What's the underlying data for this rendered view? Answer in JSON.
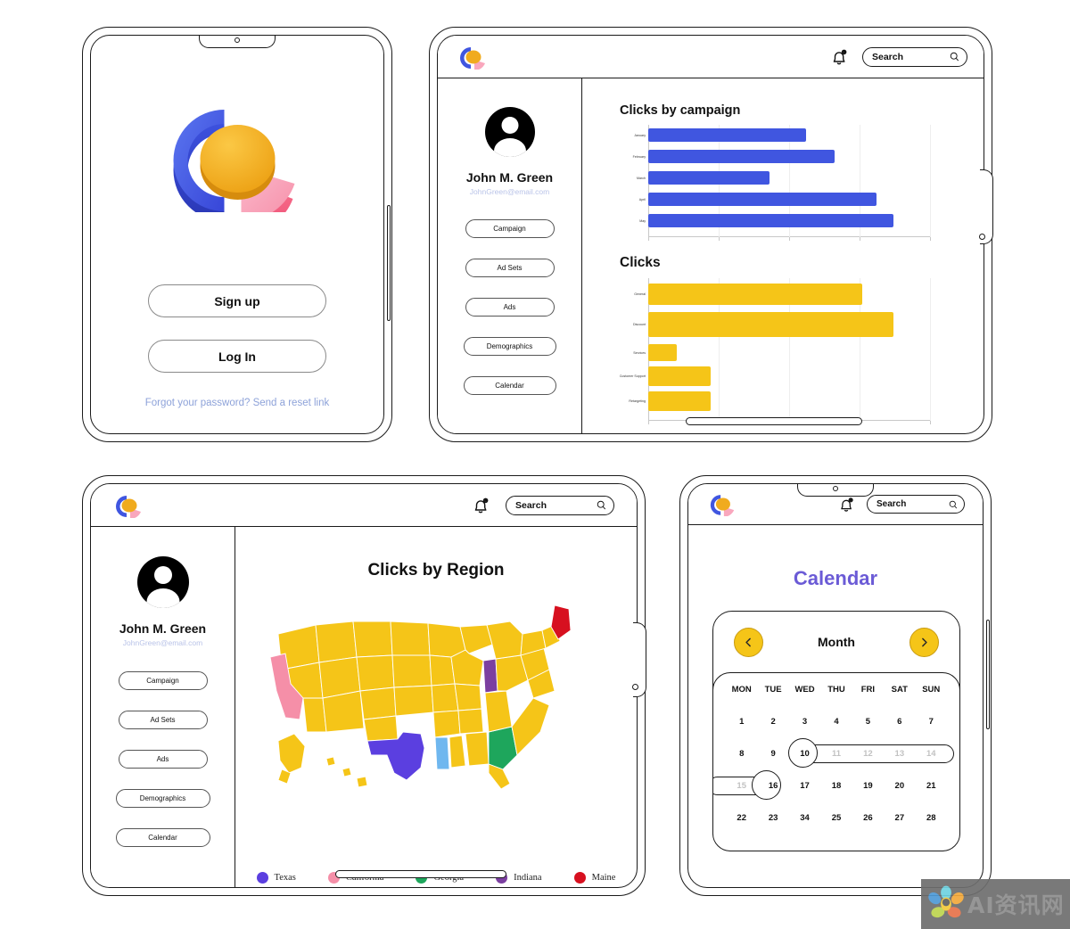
{
  "app": {
    "brand_logo": "pie-chart-logo",
    "accent_blue": "#4056e0",
    "accent_yellow": "#f5c518",
    "accent_pink": "#f9a7bd",
    "accent_purple": "#6b5bd6",
    "link_blue": "#8da2d9"
  },
  "login_screen": {
    "name": "login-tablet",
    "hero_icon": "donut-chart-3d",
    "signup_label": "Sign up",
    "login_label": "Log In",
    "reset_link": "Forgot your password? Send a reset link"
  },
  "dashboard_screen": {
    "name": "charts-tablet",
    "topbar": {
      "logo": "pie-chart-logo",
      "bell_icon": "notification-bell-icon",
      "search_placeholder": "Search",
      "search_icon": "search-icon"
    },
    "sidebar": {
      "avatar": "user-avatar",
      "user_name": "John M. Green",
      "user_email": "JohnGreen@email.com",
      "items": [
        {
          "label": "Campaign"
        },
        {
          "label": "Ad Sets"
        },
        {
          "label": "Ads"
        },
        {
          "label": "Demographics"
        },
        {
          "label": "Calendar"
        }
      ]
    }
  },
  "map_screen": {
    "name": "map-tablet",
    "topbar": {
      "logo": "pie-chart-logo",
      "bell_icon": "notification-bell-icon",
      "search_placeholder": "Search",
      "search_icon": "search-icon"
    },
    "sidebar": {
      "avatar": "user-avatar",
      "user_name": "John M. Green",
      "user_email": "JohnGreen@email.com",
      "items": [
        {
          "label": "Campaign"
        },
        {
          "label": "Ad Sets"
        },
        {
          "label": "Ads"
        },
        {
          "label": "Demographics"
        },
        {
          "label": "Calendar"
        }
      ]
    },
    "title": "Clicks by Region",
    "legend": [
      {
        "label": "Texas",
        "color": "#5b3fe0"
      },
      {
        "label": "California",
        "color": "#f58fa8"
      },
      {
        "label": "Georgia",
        "color": "#1ea65c"
      },
      {
        "label": "Indiana",
        "color": "#7b3fa0"
      },
      {
        "label": "Maine",
        "color": "#d7101f"
      }
    ],
    "map_default_color": "#f5c518"
  },
  "calendar_screen": {
    "name": "calendar-tablet",
    "topbar": {
      "logo": "pie-chart-logo",
      "bell_icon": "notification-bell-icon",
      "search_placeholder": "Search",
      "search_icon": "search-icon"
    },
    "title": "Calendar",
    "prev_icon": "chevron-left-icon",
    "next_icon": "chevron-right-icon",
    "month_label": "Month",
    "day_headers": [
      "MON",
      "TUE",
      "WED",
      "THU",
      "FRI",
      "SAT",
      "SUN"
    ],
    "weeks": [
      [
        {
          "day": "1",
          "state": "normal"
        },
        {
          "day": "2",
          "state": "normal"
        },
        {
          "day": "3",
          "state": "normal"
        },
        {
          "day": "4",
          "state": "normal"
        },
        {
          "day": "5",
          "state": "normal"
        },
        {
          "day": "6",
          "state": "normal"
        },
        {
          "day": "7",
          "state": "normal"
        }
      ],
      [
        {
          "day": "8",
          "state": "normal"
        },
        {
          "day": "9",
          "state": "normal"
        },
        {
          "day": "10",
          "state": "range-start"
        },
        {
          "day": "11",
          "state": "in-range"
        },
        {
          "day": "12",
          "state": "in-range"
        },
        {
          "day": "13",
          "state": "in-range"
        },
        {
          "day": "14",
          "state": "in-range"
        }
      ],
      [
        {
          "day": "15",
          "state": "in-range"
        },
        {
          "day": "16",
          "state": "range-end"
        },
        {
          "day": "17",
          "state": "normal"
        },
        {
          "day": "18",
          "state": "normal"
        },
        {
          "day": "19",
          "state": "normal"
        },
        {
          "day": "20",
          "state": "normal"
        },
        {
          "day": "21",
          "state": "normal"
        }
      ],
      [
        {
          "day": "22",
          "state": "normal"
        },
        {
          "day": "23",
          "state": "normal"
        },
        {
          "day": "34",
          "state": "normal"
        },
        {
          "day": "25",
          "state": "normal"
        },
        {
          "day": "26",
          "state": "normal"
        },
        {
          "day": "27",
          "state": "normal"
        },
        {
          "day": "28",
          "state": "normal"
        }
      ]
    ]
  },
  "watermark": {
    "text": "AI资讯网",
    "logo": "flower-logo"
  },
  "chart_data": [
    {
      "type": "bar",
      "orientation": "horizontal",
      "title": "Clicks by campaign",
      "categories": [
        "January",
        "February",
        "March",
        "April",
        "May"
      ],
      "values": [
        56,
        66,
        43,
        81,
        87
      ],
      "color": "#4056e0",
      "xlabel": "",
      "ylabel": "",
      "xlim": [
        0,
        100
      ],
      "grid": true,
      "legend": "none"
    },
    {
      "type": "bar",
      "orientation": "horizontal",
      "title": "Clicks",
      "categories": [
        "General",
        "Discount",
        "Services",
        "Customer Support",
        "Retargeting"
      ],
      "values": [
        76,
        87,
        10,
        22,
        22
      ],
      "color": "#f5c518",
      "xlabel": "",
      "ylabel": "",
      "xlim": [
        0,
        100
      ],
      "grid": true,
      "legend": "none"
    }
  ]
}
